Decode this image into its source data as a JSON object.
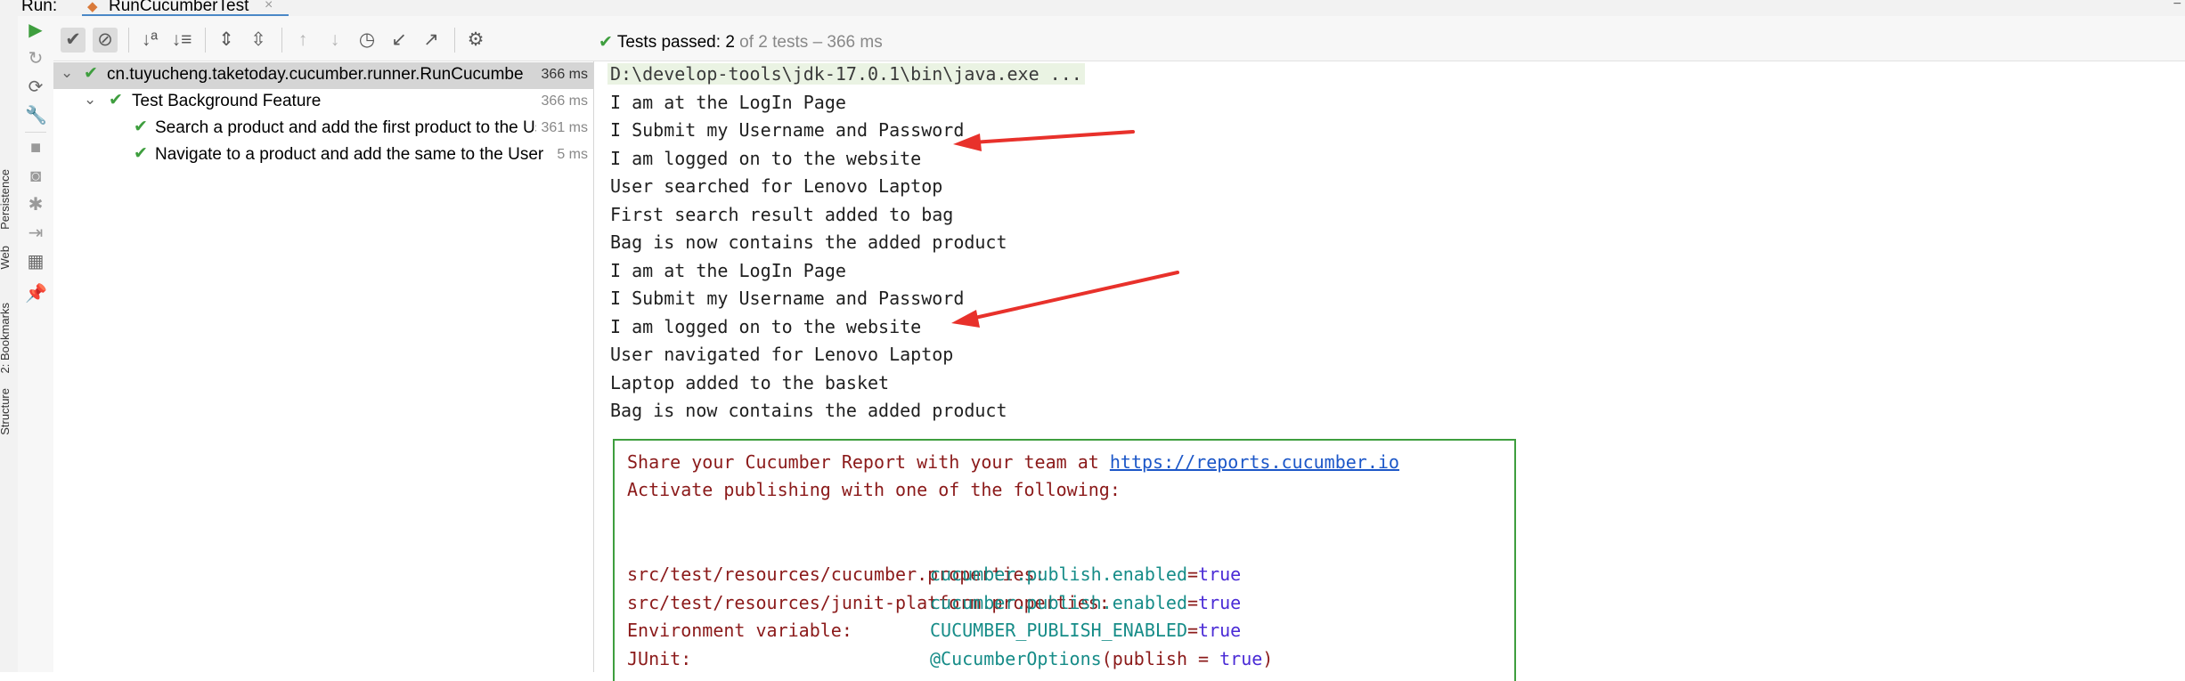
{
  "run_bar": {
    "label": "Run:",
    "tab_title": "RunCucumberTest",
    "tab_icon": "cucumber-run-icon",
    "close_glyph": "×"
  },
  "side_tabs": [
    "Persistence",
    "Web",
    "2: Bookmarks",
    "Structure"
  ],
  "toolbar": {
    "status_passed": "Tests passed:",
    "status_count": "2",
    "status_of": "of 2 tests",
    "status_sep": "–",
    "status_time": "366 ms"
  },
  "tree": {
    "rows": [
      {
        "label": "cn.tuyucheng.taketoday.cucumber.runner.RunCucumberTest",
        "time": "366 ms"
      },
      {
        "label": "Test Background Feature",
        "time": "366 ms"
      },
      {
        "label": "Search a product and add the first product to the User basket",
        "time": "361 ms"
      },
      {
        "label": "Navigate to a product and add the same to the User basket",
        "time": "5 ms"
      }
    ]
  },
  "console": {
    "command": "D:\\develop-tools\\jdk-17.0.1\\bin\\java.exe ...",
    "lines": [
      "I am at the LogIn Page",
      "I Submit my Username and Password",
      "I am logged on to the website",
      "User searched for Lenovo Laptop",
      "First search result added to bag",
      "Bag is now contains the added product",
      "I am at the LogIn Page",
      "I Submit my Username and Password",
      "I am logged on to the website",
      "User navigated for Lenovo Laptop",
      "Laptop added to the basket",
      "Bag is now contains the added product"
    ],
    "banner": {
      "share_prefix": "Share your Cucumber Report with your team at ",
      "share_link": "https://reports.cucumber.io",
      "activate": "Activate publishing with one of the following:",
      "rows": [
        {
          "key": "src/test/resources/cucumber.properties:",
          "name": "cucumber.publish.enabled",
          "eq": "=",
          "val": "true"
        },
        {
          "key": "src/test/resources/junit-platform.properties:",
          "name": "cucumber.publish.enabled",
          "eq": "=",
          "val": "true"
        },
        {
          "key": "Environment variable:",
          "name": "CUCUMBER_PUBLISH_ENABLED",
          "eq": "=",
          "val": "true"
        },
        {
          "key": "JUnit:",
          "name": "@CucumberOptions",
          "eq": "(publish = ",
          "val": "true",
          "close": ")"
        }
      ]
    }
  },
  "colors": {
    "pass_green": "#3e9e3e",
    "arrow_red": "#e8312b",
    "banner_text": "#8b1a1a",
    "banner_value": "#168c88",
    "link_blue": "#1c57c8"
  }
}
